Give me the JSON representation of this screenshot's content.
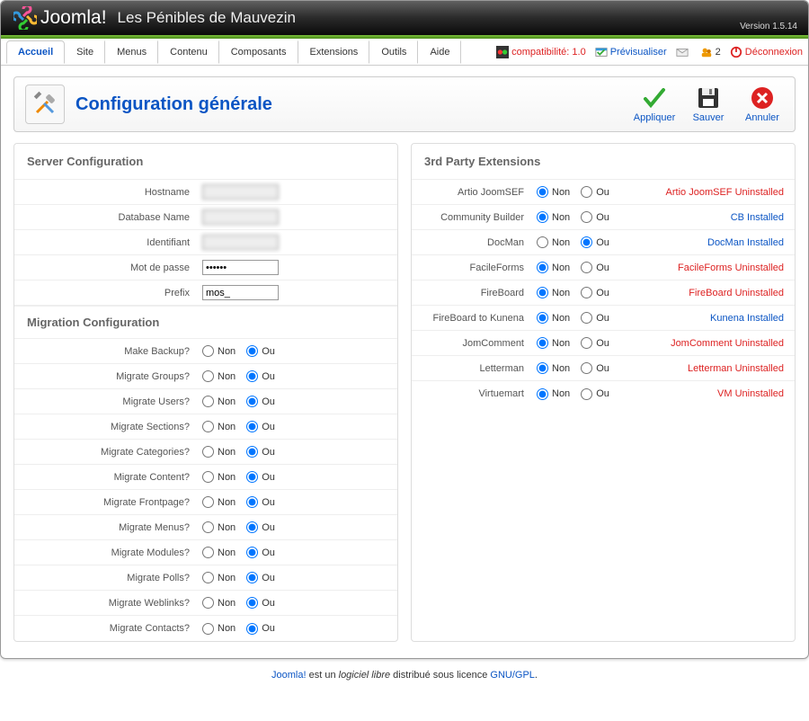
{
  "header": {
    "brand": "Joomla!",
    "site": "Les Pénibles de Mauvezin",
    "version": "Version 1.5.14"
  },
  "menu": {
    "active": "Accueil",
    "items": [
      "Accueil",
      "Site",
      "Menus",
      "Contenu",
      "Composants",
      "Extensions",
      "Outils",
      "Aide"
    ]
  },
  "topright": {
    "compat": "compatibilité: 1.0",
    "preview": "Prévisualiser",
    "mail_count": "",
    "user_count": "2",
    "disconnect": "Déconnexion"
  },
  "page": {
    "title": "Configuration générale",
    "toolbar": {
      "apply": "Appliquer",
      "save": "Sauver",
      "cancel": "Annuler"
    }
  },
  "server": {
    "title": "Server Configuration",
    "hostname_label": "Hostname",
    "hostname_value": "",
    "dbname_label": "Database Name",
    "dbname_value": "",
    "user_label": "Identifiant",
    "user_value": "",
    "pass_label": "Mot de passe",
    "pass_value": "••••••",
    "prefix_label": "Prefix",
    "prefix_value": "mos_"
  },
  "migration": {
    "title": "Migration Configuration",
    "non": "Non",
    "ou": "Ou",
    "rows": [
      {
        "label": "Make Backup?",
        "selected": "ou"
      },
      {
        "label": "Migrate Groups?",
        "selected": "ou"
      },
      {
        "label": "Migrate Users?",
        "selected": "ou"
      },
      {
        "label": "Migrate Sections?",
        "selected": "ou"
      },
      {
        "label": "Migrate Categories?",
        "selected": "ou"
      },
      {
        "label": "Migrate Content?",
        "selected": "ou"
      },
      {
        "label": "Migrate Frontpage?",
        "selected": "ou"
      },
      {
        "label": "Migrate Menus?",
        "selected": "ou"
      },
      {
        "label": "Migrate Modules?",
        "selected": "ou"
      },
      {
        "label": "Migrate Polls?",
        "selected": "ou"
      },
      {
        "label": "Migrate Weblinks?",
        "selected": "ou"
      },
      {
        "label": "Migrate Contacts?",
        "selected": "ou"
      }
    ]
  },
  "ext": {
    "title": "3rd Party Extensions",
    "non": "Non",
    "ou": "Ou",
    "rows": [
      {
        "label": "Artio JoomSEF",
        "selected": "non",
        "status": "Artio JoomSEF Uninstalled",
        "color": "red"
      },
      {
        "label": "Community Builder",
        "selected": "non",
        "status": "CB Installed",
        "color": "blue"
      },
      {
        "label": "DocMan",
        "selected": "ou",
        "status": "DocMan Installed",
        "color": "blue"
      },
      {
        "label": "FacileForms",
        "selected": "non",
        "status": "FacileForms Uninstalled",
        "color": "red"
      },
      {
        "label": "FireBoard",
        "selected": "non",
        "status": "FireBoard Uninstalled",
        "color": "red"
      },
      {
        "label": "FireBoard to Kunena",
        "selected": "non",
        "status": "Kunena Installed",
        "color": "blue"
      },
      {
        "label": "JomComment",
        "selected": "non",
        "status": "JomComment Uninstalled",
        "color": "red"
      },
      {
        "label": "Letterman",
        "selected": "non",
        "status": "Letterman Uninstalled",
        "color": "red"
      },
      {
        "label": "Virtuemart",
        "selected": "non",
        "status": "VM Uninstalled",
        "color": "red"
      }
    ]
  },
  "footer": {
    "pre": "Joomla!",
    "mid1": " est un ",
    "em": "logiciel libre",
    "mid2": " distribué sous licence ",
    "link": "GNU/GPL",
    "end": "."
  }
}
